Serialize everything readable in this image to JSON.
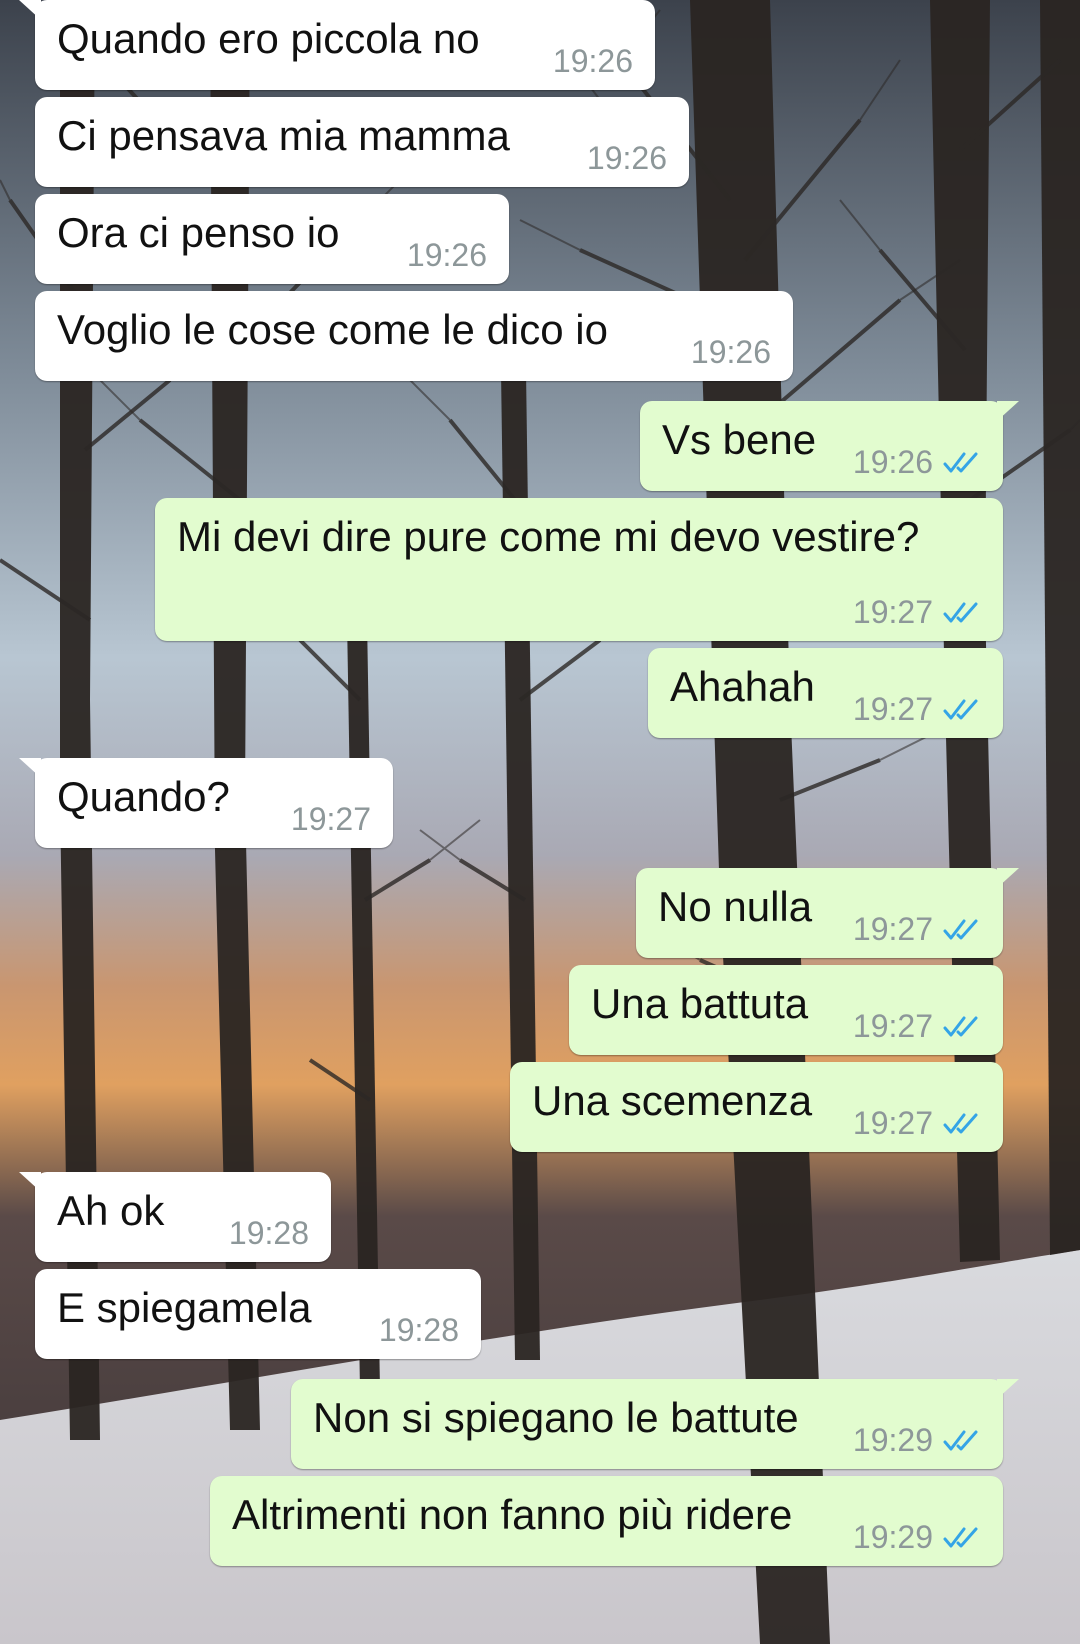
{
  "colors": {
    "incoming_bubble": "#ffffff",
    "outgoing_bubble": "#e2fccf",
    "timestamp": "#8d9799",
    "read_ticks": "#34a4e6"
  },
  "icons": {
    "read_receipt": "double-check-icon"
  },
  "messages": [
    {
      "text": "Quando ero piccola no",
      "time": "19:26",
      "direction": "in"
    },
    {
      "text": "Ci pensava mia mamma",
      "time": "19:26",
      "direction": "in"
    },
    {
      "text": "Ora ci penso io",
      "time": "19:26",
      "direction": "in"
    },
    {
      "text": "Voglio le cose come le dico io",
      "time": "19:26",
      "direction": "in"
    },
    {
      "text": "Vs bene",
      "time": "19:26",
      "direction": "out"
    },
    {
      "text": "Mi devi dire pure come mi devo vestire?",
      "time": "19:27",
      "direction": "out"
    },
    {
      "text": "Ahahah",
      "time": "19:27",
      "direction": "out"
    },
    {
      "text": "Quando?",
      "time": "19:27",
      "direction": "in"
    },
    {
      "text": "No nulla",
      "time": "19:27",
      "direction": "out"
    },
    {
      "text": "Una battuta",
      "time": "19:27",
      "direction": "out"
    },
    {
      "text": "Una scemenza",
      "time": "19:27",
      "direction": "out"
    },
    {
      "text": "Ah ok",
      "time": "19:28",
      "direction": "in"
    },
    {
      "text": "E spiegamela",
      "time": "19:28",
      "direction": "in"
    },
    {
      "text": "Non si spiegano le battute",
      "time": "19:29",
      "direction": "out"
    },
    {
      "text": "Altrimenti non fanno più ridere",
      "time": "19:29",
      "direction": "out"
    }
  ]
}
